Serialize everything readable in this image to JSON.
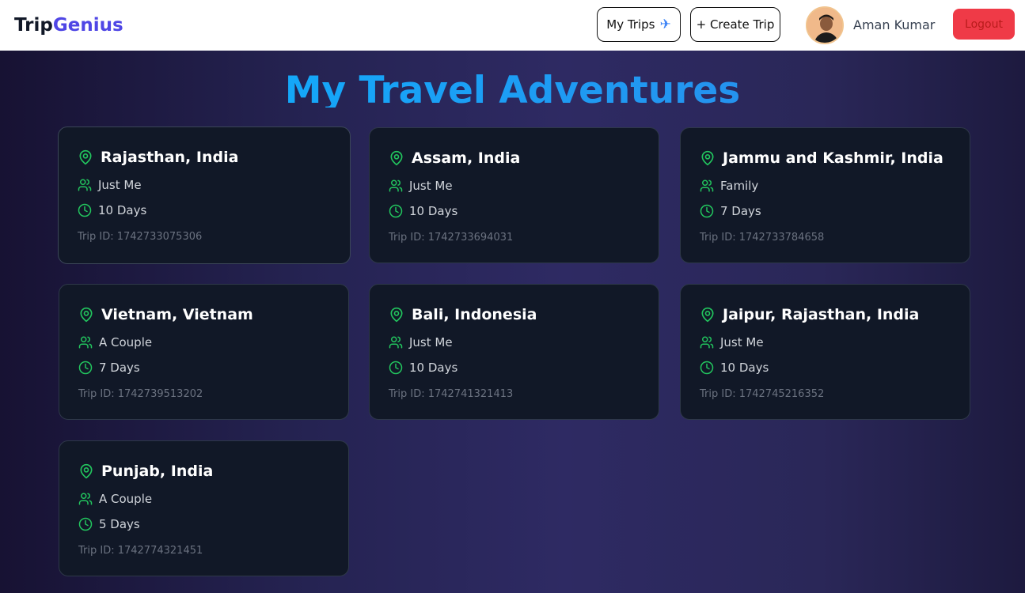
{
  "header": {
    "logo_part1": "Trip",
    "logo_part2": "Genius",
    "my_trips_label": "My Trips",
    "create_trip_label": "+ Create Trip",
    "user_name": "Aman Kumar",
    "logout_label": "Logout"
  },
  "main": {
    "title": "My Travel Adventures",
    "trips": [
      {
        "destination": "Rajasthan, India",
        "travelers": "Just Me",
        "duration": "10 Days",
        "trip_id": "Trip ID: 1742733075306"
      },
      {
        "destination": "Assam, India",
        "travelers": "Just Me",
        "duration": "10 Days",
        "trip_id": "Trip ID: 1742733694031"
      },
      {
        "destination": "Jammu and Kashmir, India",
        "travelers": "Family",
        "duration": "7 Days",
        "trip_id": "Trip ID: 1742733784658"
      },
      {
        "destination": "Vietnam, Vietnam",
        "travelers": "A Couple",
        "duration": "7 Days",
        "trip_id": "Trip ID: 1742739513202"
      },
      {
        "destination": "Bali, Indonesia",
        "travelers": "Just Me",
        "duration": "10 Days",
        "trip_id": "Trip ID: 1742741321413"
      },
      {
        "destination": "Jaipur, Rajasthan, India",
        "travelers": "Just Me",
        "duration": "10 Days",
        "trip_id": "Trip ID: 1742745216352"
      },
      {
        "destination": "Punjab, India",
        "travelers": "A Couple",
        "duration": "5 Days",
        "trip_id": "Trip ID: 1742774321451"
      }
    ]
  },
  "icons": {
    "location": "map-pin-icon",
    "travelers": "users-icon",
    "duration": "clock-icon",
    "plane": "airplane-icon"
  },
  "colors": {
    "accent_green": "#22c55e",
    "logo_accent": "#4f46e5",
    "logout_bg": "#ef3a47",
    "title_blue": "#0ab4ff",
    "card_bg": "#111827"
  }
}
